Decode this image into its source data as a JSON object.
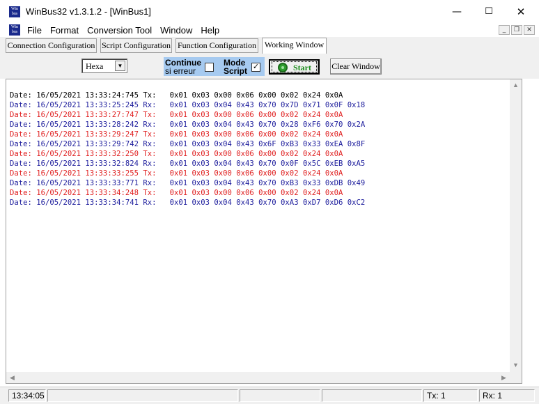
{
  "window": {
    "title": "WinBus32 v1.3.1.2  - [WinBus1]",
    "icon": "winbus-logo",
    "logo_text_line1": "Win",
    "logo_text_line2": "bus",
    "minimize_glyph": "—",
    "maximize_glyph": "☐",
    "close_glyph": "✕"
  },
  "menu": {
    "items": [
      "File",
      "Format",
      "Conversion Tool",
      "Window",
      "Help"
    ],
    "mdi_minimize": "_",
    "mdi_restore": "❐",
    "mdi_close": "✕"
  },
  "tabs": [
    {
      "label": "Connection Configuration",
      "active": false
    },
    {
      "label": "Script Configuration",
      "active": false
    },
    {
      "label": "Function Configuration",
      "active": false
    },
    {
      "label": "Working Window",
      "active": true
    }
  ],
  "toolbar": {
    "format_select": {
      "value": "Hexa",
      "arrow": "▼"
    },
    "continue_on_error": {
      "label_line1": "Continue",
      "label_line2": "si erreur",
      "checked": false
    },
    "script_mode": {
      "label_line1": "Mode",
      "label_line2": "Script",
      "checked": true,
      "check_glyph": "✓"
    },
    "start_label": "Start",
    "clear_label": "Clear Window",
    "panel_color": "#a6caf0",
    "start_color": "#1b8b1b"
  },
  "colors": {
    "tx_first": "#000000",
    "tx": "#e02020",
    "rx": "#1c1c9c"
  },
  "log": [
    {
      "type": "tx0",
      "text": "Date: 16/05/2021 13:33:24:745 Tx:   0x01 0x03 0x00 0x06 0x00 0x02 0x24 0x0A"
    },
    {
      "type": "rx",
      "text": "Date: 16/05/2021 13:33:25:245 Rx:   0x01 0x03 0x04 0x43 0x70 0x7D 0x71 0x0F 0x18"
    },
    {
      "type": "tx",
      "text": "Date: 16/05/2021 13:33:27:747 Tx:   0x01 0x03 0x00 0x06 0x00 0x02 0x24 0x0A"
    },
    {
      "type": "rx",
      "text": "Date: 16/05/2021 13:33:28:242 Rx:   0x01 0x03 0x04 0x43 0x70 0x28 0xF6 0x70 0x2A"
    },
    {
      "type": "tx",
      "text": "Date: 16/05/2021 13:33:29:247 Tx:   0x01 0x03 0x00 0x06 0x00 0x02 0x24 0x0A"
    },
    {
      "type": "rx",
      "text": "Date: 16/05/2021 13:33:29:742 Rx:   0x01 0x03 0x04 0x43 0x6F 0xB3 0x33 0xEA 0x8F"
    },
    {
      "type": "tx",
      "text": "Date: 16/05/2021 13:33:32:250 Tx:   0x01 0x03 0x00 0x06 0x00 0x02 0x24 0x0A"
    },
    {
      "type": "rx",
      "text": "Date: 16/05/2021 13:33:32:824 Rx:   0x01 0x03 0x04 0x43 0x70 0x0F 0x5C 0xEB 0xA5"
    },
    {
      "type": "tx",
      "text": "Date: 16/05/2021 13:33:33:255 Tx:   0x01 0x03 0x00 0x06 0x00 0x02 0x24 0x0A"
    },
    {
      "type": "rx",
      "text": "Date: 16/05/2021 13:33:33:771 Rx:   0x01 0x03 0x04 0x43 0x70 0xB3 0x33 0xDB 0x49"
    },
    {
      "type": "tx",
      "text": "Date: 16/05/2021 13:33:34:248 Tx:   0x01 0x03 0x00 0x06 0x00 0x02 0x24 0x0A"
    },
    {
      "type": "rx",
      "text": "Date: 16/05/2021 13:33:34:741 Rx:   0x01 0x03 0x04 0x43 0x70 0xA3 0xD7 0xD6 0xC2"
    }
  ],
  "scroll": {
    "up": "▲",
    "down": "▼",
    "left": "◀",
    "right": "▶"
  },
  "status": {
    "time": "13:34:05",
    "tx": "Tx: 1",
    "rx": "Rx: 1"
  }
}
